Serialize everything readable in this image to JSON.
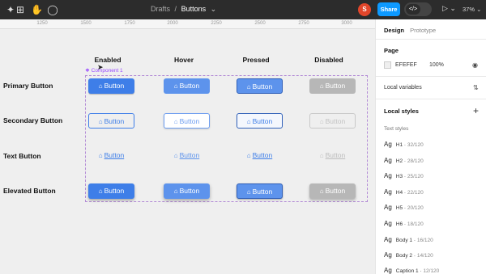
{
  "toolbar": {
    "breadcrumb_parent": "Drafts",
    "breadcrumb_sep": "/",
    "breadcrumb_current": "Buttons",
    "avatar_initial": "S",
    "share_label": "Share",
    "devmode_glyph": "</>",
    "zoom_label": "37%",
    "accent": "#0d99ff"
  },
  "ruler": {
    "ticks": [
      "1250",
      "1500",
      "1750",
      "2000",
      "2250",
      "2500",
      "2750",
      "3000"
    ]
  },
  "canvas": {
    "component_label": "Component 1",
    "columns": [
      "Enabled",
      "Hover",
      "Pressed",
      "Disabled"
    ],
    "rows": [
      "Primary Button",
      "Secondary Button",
      "Text Button",
      "Elevated Button"
    ],
    "button_label": "Button",
    "button_icon": "home-icon",
    "primary_color": "#3e7ee8",
    "disabled_color": "#b7b7b7"
  },
  "panel": {
    "tab_design": "Design",
    "tab_prototype": "Prototype",
    "page_heading": "Page",
    "page_color_hex": "EFEFEF",
    "page_opacity": "100%",
    "local_variables": "Local variables",
    "local_styles": "Local styles",
    "text_styles_heading": "Text styles",
    "text_styles": [
      {
        "name": "H1",
        "size": "32/120"
      },
      {
        "name": "H2",
        "size": "28/120"
      },
      {
        "name": "H3",
        "size": "25/120"
      },
      {
        "name": "H4",
        "size": "22/120"
      },
      {
        "name": "H5",
        "size": "20/120"
      },
      {
        "name": "H6",
        "size": "18/120"
      },
      {
        "name": "Body 1",
        "size": "16/120"
      },
      {
        "name": "Body 2",
        "size": "14/120"
      },
      {
        "name": "Caption 1",
        "size": "12/120"
      }
    ],
    "ag_glyph": "Ag"
  }
}
